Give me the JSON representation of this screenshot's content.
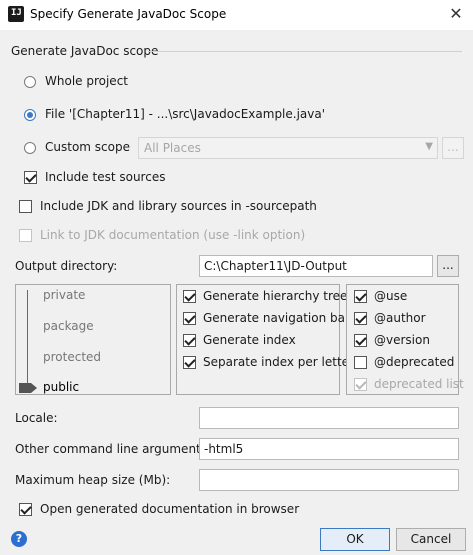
{
  "window": {
    "title": "Specify Generate JavaDoc Scope",
    "app_icon_text": "IJ",
    "close_glyph": "✕"
  },
  "group": {
    "title": "Generate JavaDoc scope"
  },
  "scope": {
    "whole_project": {
      "label": "Whole project",
      "selected": false
    },
    "file": {
      "label": "File '[Chapter11] - ...\\src\\JavadocExample.java'",
      "selected": true
    },
    "custom": {
      "label": "Custom scope",
      "selected": false,
      "combo_value": "All Places",
      "browse_label": "..."
    },
    "include_tests": {
      "label": "Include test sources",
      "checked": true
    }
  },
  "include_jdk": {
    "label": "Include JDK and library sources in -sourcepath",
    "checked": false
  },
  "link_jdk": {
    "label": "Link to JDK documentation (use -link option)",
    "checked": false,
    "disabled": true
  },
  "output": {
    "label": "Output directory:",
    "value": "C:\\Chapter11\\JD-Output",
    "browse_label": "..."
  },
  "visibility": {
    "levels": [
      "private",
      "package",
      "protected",
      "public"
    ],
    "selected": "public"
  },
  "options": [
    {
      "label": "Generate hierarchy tree",
      "checked": true
    },
    {
      "label": "Generate navigation bar",
      "checked": true
    },
    {
      "label": "Generate index",
      "checked": true
    },
    {
      "label": "Separate index per letter",
      "checked": true
    }
  ],
  "tags": [
    {
      "label": "@use",
      "checked": true,
      "disabled": false
    },
    {
      "label": "@author",
      "checked": true,
      "disabled": false
    },
    {
      "label": "@version",
      "checked": true,
      "disabled": false
    },
    {
      "label": "@deprecated",
      "checked": false,
      "disabled": false
    },
    {
      "label": "deprecated list",
      "checked": true,
      "disabled": true
    }
  ],
  "locale": {
    "label": "Locale:",
    "value": ""
  },
  "other_args": {
    "label": "Other command line arguments:",
    "value": "-html5"
  },
  "heap": {
    "label": "Maximum heap size (Mb):",
    "value": ""
  },
  "open_browser": {
    "label": "Open generated documentation in browser",
    "checked": true
  },
  "buttons": {
    "ok": "OK",
    "cancel": "Cancel",
    "help": "?"
  },
  "colors": {
    "accent": "#3b79c0",
    "slider": "#b34a3a",
    "help": "#2b6fd0"
  }
}
